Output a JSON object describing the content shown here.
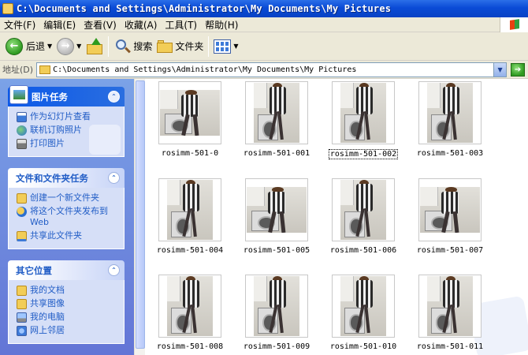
{
  "window": {
    "title": "C:\\Documents and Settings\\Administrator\\My Documents\\My Pictures"
  },
  "menu": [
    {
      "label": "文件(F)"
    },
    {
      "label": "编辑(E)"
    },
    {
      "label": "查看(V)"
    },
    {
      "label": "收藏(A)"
    },
    {
      "label": "工具(T)"
    },
    {
      "label": "帮助(H)"
    }
  ],
  "toolbar": {
    "back_label": "后退",
    "search_label": "搜索",
    "folders_label": "文件夹",
    "icons": {
      "back": "back-arrow-icon",
      "forward": "forward-arrow-icon",
      "up": "folder-up-icon",
      "search": "search-icon",
      "folders": "folder-icon",
      "views": "views-icon"
    }
  },
  "address": {
    "label": "地址(D)",
    "path": "C:\\Documents and Settings\\Administrator\\My Documents\\My Pictures"
  },
  "sidebar": {
    "panels": [
      {
        "title": "图片任务",
        "style": "special",
        "tasks": [
          {
            "label": "作为幻灯片查看",
            "icon": "slideshow-icon"
          },
          {
            "label": "联机订购照片",
            "icon": "globe-icon"
          },
          {
            "label": "打印图片",
            "icon": "printer-icon"
          }
        ]
      },
      {
        "title": "文件和文件夹任务",
        "style": "normal",
        "tasks": [
          {
            "label": "创建一个新文件夹",
            "icon": "new-folder-icon"
          },
          {
            "label": "将这个文件夹发布到Web",
            "icon": "publish-web-icon"
          },
          {
            "label": "共享此文件夹",
            "icon": "share-folder-icon"
          }
        ]
      },
      {
        "title": "其它位置",
        "style": "normal",
        "tasks": [
          {
            "label": "我的文档",
            "icon": "my-documents-icon"
          },
          {
            "label": "共享图像",
            "icon": "shared-pictures-icon"
          },
          {
            "label": "我的电脑",
            "icon": "my-computer-icon"
          },
          {
            "label": "网上邻居",
            "icon": "network-places-icon"
          }
        ]
      }
    ]
  },
  "files": [
    {
      "name": "rosimm-501-0",
      "orientation": "landscape",
      "selected": false
    },
    {
      "name": "rosimm-501-001",
      "orientation": "portrait",
      "selected": false
    },
    {
      "name": "rosimm-501-002",
      "orientation": "portrait",
      "selected": true
    },
    {
      "name": "rosimm-501-003",
      "orientation": "portrait",
      "selected": false
    },
    {
      "name": "rosimm-501-004",
      "orientation": "portrait",
      "selected": false
    },
    {
      "name": "rosimm-501-005",
      "orientation": "landscape",
      "selected": false
    },
    {
      "name": "rosimm-501-006",
      "orientation": "portrait",
      "selected": false
    },
    {
      "name": "rosimm-501-007",
      "orientation": "landscape",
      "selected": false
    },
    {
      "name": "rosimm-501-008",
      "orientation": "portrait",
      "selected": false
    },
    {
      "name": "rosimm-501-009",
      "orientation": "portrait",
      "selected": false
    },
    {
      "name": "rosimm-501-010",
      "orientation": "portrait",
      "selected": false
    },
    {
      "name": "rosimm-501-011",
      "orientation": "portrait",
      "selected": false
    }
  ],
  "colors": {
    "titlebar": "#0a4bd6",
    "sidebar": "#6f8fe0",
    "task_link": "#215dc6"
  }
}
